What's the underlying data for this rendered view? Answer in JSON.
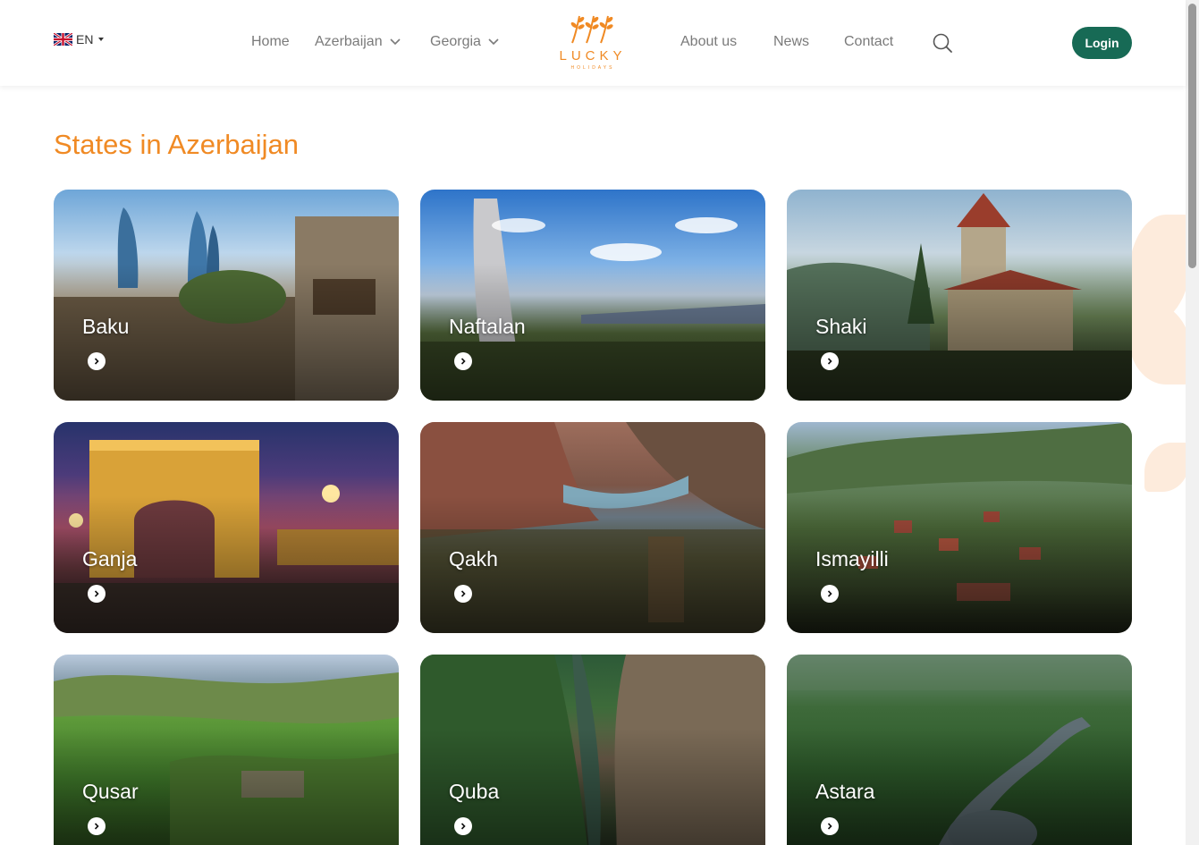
{
  "header": {
    "language": {
      "code": "EN",
      "flag_icon": "uk-flag-icon"
    },
    "nav": [
      {
        "label": "Home",
        "dropdown": false
      },
      {
        "label": "Azerbaijan",
        "dropdown": true
      },
      {
        "label": "Georgia",
        "dropdown": true
      },
      {
        "label": "About us",
        "dropdown": false
      },
      {
        "label": "News",
        "dropdown": false
      },
      {
        "label": "Contact",
        "dropdown": false
      }
    ],
    "logo": {
      "word": "LUCKY",
      "sub": "HOLIDAYS"
    },
    "login_label": "Login"
  },
  "colors": {
    "accent": "#f08a24",
    "brand_green": "#176a55"
  },
  "main": {
    "title": "States in Azerbaijan",
    "states": [
      {
        "name": "Baku"
      },
      {
        "name": "Naftalan"
      },
      {
        "name": "Shaki"
      },
      {
        "name": "Ganja"
      },
      {
        "name": "Qakh"
      },
      {
        "name": "Ismayilli"
      },
      {
        "name": "Qusar"
      },
      {
        "name": "Quba"
      },
      {
        "name": "Astara"
      }
    ]
  }
}
